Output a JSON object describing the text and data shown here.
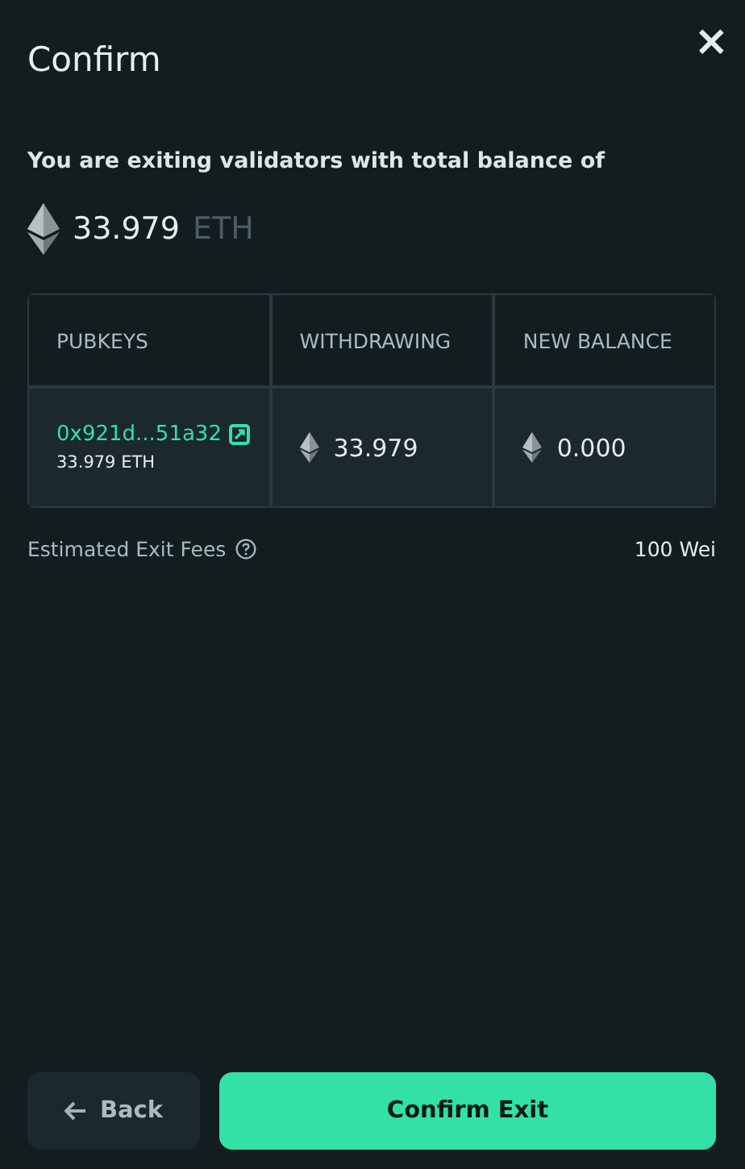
{
  "dialog": {
    "title": "Confirm",
    "close": "×"
  },
  "summary": {
    "text": "You are exiting validators with total balance of",
    "amount": "33.979",
    "unit": "ETH"
  },
  "table": {
    "columns": [
      "PUBKEYS",
      "WITHDRAWING",
      "NEW BALANCE"
    ],
    "rows": [
      {
        "pubkey": "0x921d...51a32",
        "pubkey_balance": "33.979 ETH",
        "withdrawing": "33.979",
        "new_balance": "0.000"
      }
    ]
  },
  "fees": {
    "label": "Estimated Exit Fees",
    "value": "100 Wei"
  },
  "buttons": [
    {
      "kind": "secondary",
      "label": "Back"
    },
    {
      "kind": "primary",
      "label": "Confirm Exit"
    }
  ]
}
